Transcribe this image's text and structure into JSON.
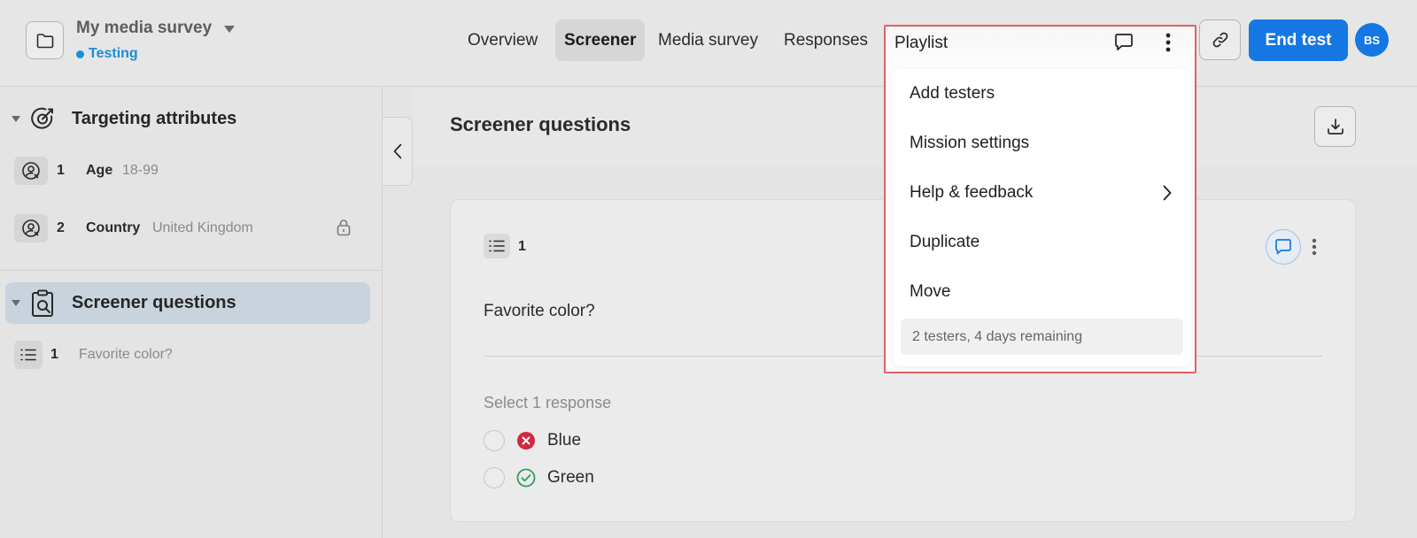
{
  "header": {
    "survey_title": "My media survey",
    "status": "Testing",
    "tabs": [
      {
        "label": "Overview"
      },
      {
        "label": "Screener"
      },
      {
        "label": "Media survey"
      },
      {
        "label": "Responses"
      }
    ],
    "active_tab": "Screener",
    "end_button": "End test",
    "avatar_initials": "BS"
  },
  "sidebar": {
    "targeting": {
      "label": "Targeting attributes",
      "items": [
        {
          "num": "1",
          "name": "Age",
          "value": "18-99"
        },
        {
          "num": "2",
          "name": "Country",
          "value": "United Kingdom"
        }
      ]
    },
    "screener": {
      "label": "Screener questions",
      "items": [
        {
          "num": "1",
          "text": "Favorite color?"
        }
      ]
    }
  },
  "main": {
    "title": "Screener questions",
    "question": {
      "num": "1",
      "text": "Favorite color?",
      "instruction": "Select 1 response",
      "options": [
        {
          "label": "Blue",
          "status": "rejected"
        },
        {
          "label": "Green",
          "status": "accepted"
        }
      ]
    }
  },
  "dropdown": {
    "header_label": "Playlist",
    "items": [
      {
        "label": "Add testers"
      },
      {
        "label": "Mission settings"
      },
      {
        "label": "Help & feedback",
        "has_submenu": true
      },
      {
        "label": "Duplicate"
      },
      {
        "label": "Move"
      }
    ],
    "footer": "2 testers, 4 days remaining"
  },
  "colors": {
    "accent": "#1577e3",
    "status": "#1a8fd6",
    "highlight": "#e06266",
    "reject": "#d0293d",
    "accept": "#2e9e5e"
  }
}
